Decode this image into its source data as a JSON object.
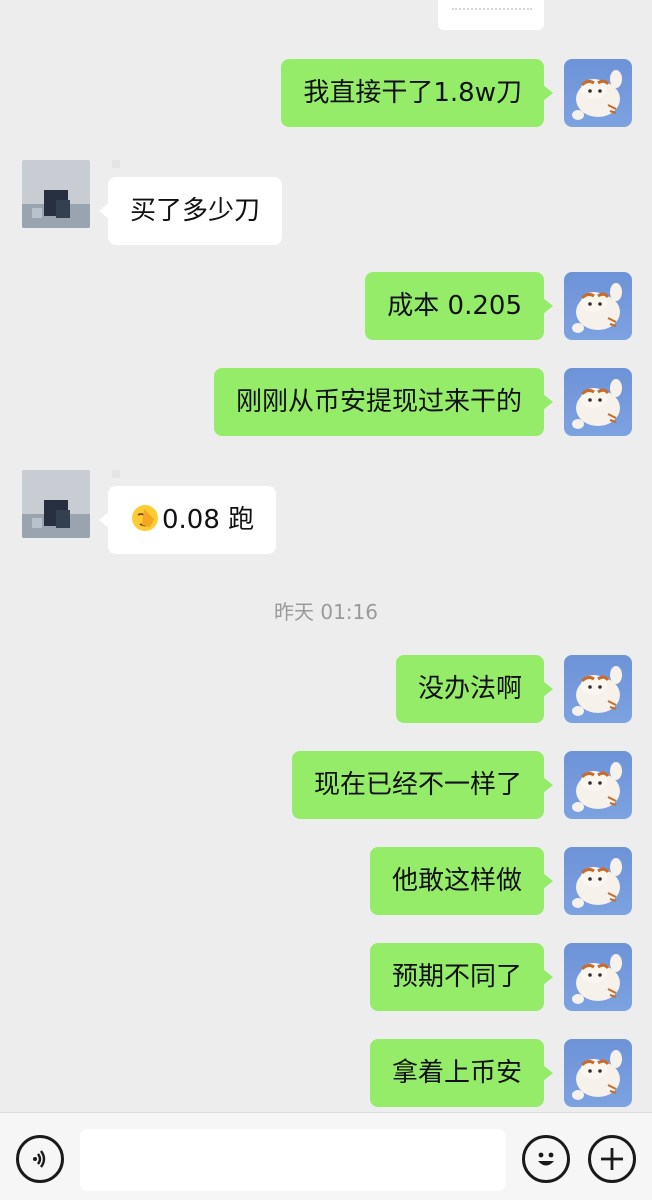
{
  "messages": [
    {
      "side": "me",
      "text": "我直接干了1.8w刀"
    },
    {
      "side": "other",
      "text": "买了多少刀"
    },
    {
      "side": "me",
      "text": "成本 0.205"
    },
    {
      "side": "me",
      "text": "刚刚从币安提现过来干的"
    },
    {
      "side": "other",
      "text": "0.08 跑",
      "emoji": "facepalm-emoji"
    },
    {
      "side": "me",
      "text": "没办法啊"
    },
    {
      "side": "me",
      "text": "现在已经不一样了"
    },
    {
      "side": "me",
      "text": "他敢这样做"
    },
    {
      "side": "me",
      "text": "预期不同了"
    },
    {
      "side": "me",
      "text": "拿着上币安"
    }
  ],
  "timestamp": "昨天 01:16",
  "input": {
    "value": ""
  },
  "icons": {
    "voice": "voice-icon",
    "emoji": "emoji-icon",
    "plus": "plus-icon"
  },
  "colors": {
    "background": "#ededed",
    "my_bubble": "#95ec69",
    "their_bubble": "#ffffff",
    "timestamp": "#9a9a9a"
  }
}
